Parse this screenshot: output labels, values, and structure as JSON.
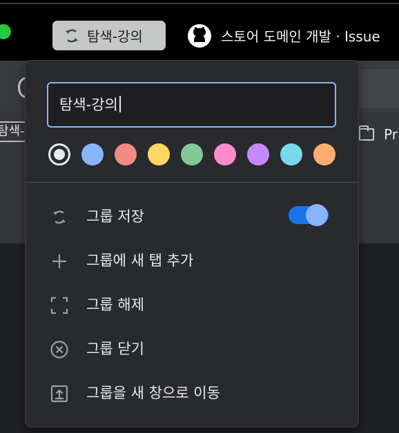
{
  "window": {
    "group_chip_label": "탐색-강의",
    "active_tab_title": "스토어 도메인 개발 · Issue"
  },
  "bookmarks": {
    "partial_chip_text": "탐색-강",
    "folder_text": "Pr"
  },
  "group_editor": {
    "name_value": "탐색-강의",
    "colors": [
      {
        "name": "grey",
        "hex": "#e8eaed",
        "selected": true
      },
      {
        "name": "blue",
        "hex": "#8ab4f8",
        "selected": false
      },
      {
        "name": "red",
        "hex": "#f28b82",
        "selected": false
      },
      {
        "name": "yellow",
        "hex": "#fdd663",
        "selected": false
      },
      {
        "name": "green",
        "hex": "#81c995",
        "selected": false
      },
      {
        "name": "pink",
        "hex": "#ff8bcb",
        "selected": false
      },
      {
        "name": "purple",
        "hex": "#c58af9",
        "selected": false
      },
      {
        "name": "cyan",
        "hex": "#78d9ec",
        "selected": false
      },
      {
        "name": "orange",
        "hex": "#fcad70",
        "selected": false
      }
    ],
    "menu": {
      "save_group": {
        "label": "그룹 저장",
        "icon": "sync-icon",
        "toggle_on": true
      },
      "add_tab": {
        "label": "그룹에 새 탭 추가",
        "icon": "plus-icon"
      },
      "ungroup": {
        "label": "그룹 해제",
        "icon": "ungroup-icon"
      },
      "close_group": {
        "label": "그룹 닫기",
        "icon": "close-circle-icon"
      },
      "move_to_window": {
        "label": "그룹을 새 창으로 이동",
        "icon": "move-to-window-icon"
      }
    }
  }
}
